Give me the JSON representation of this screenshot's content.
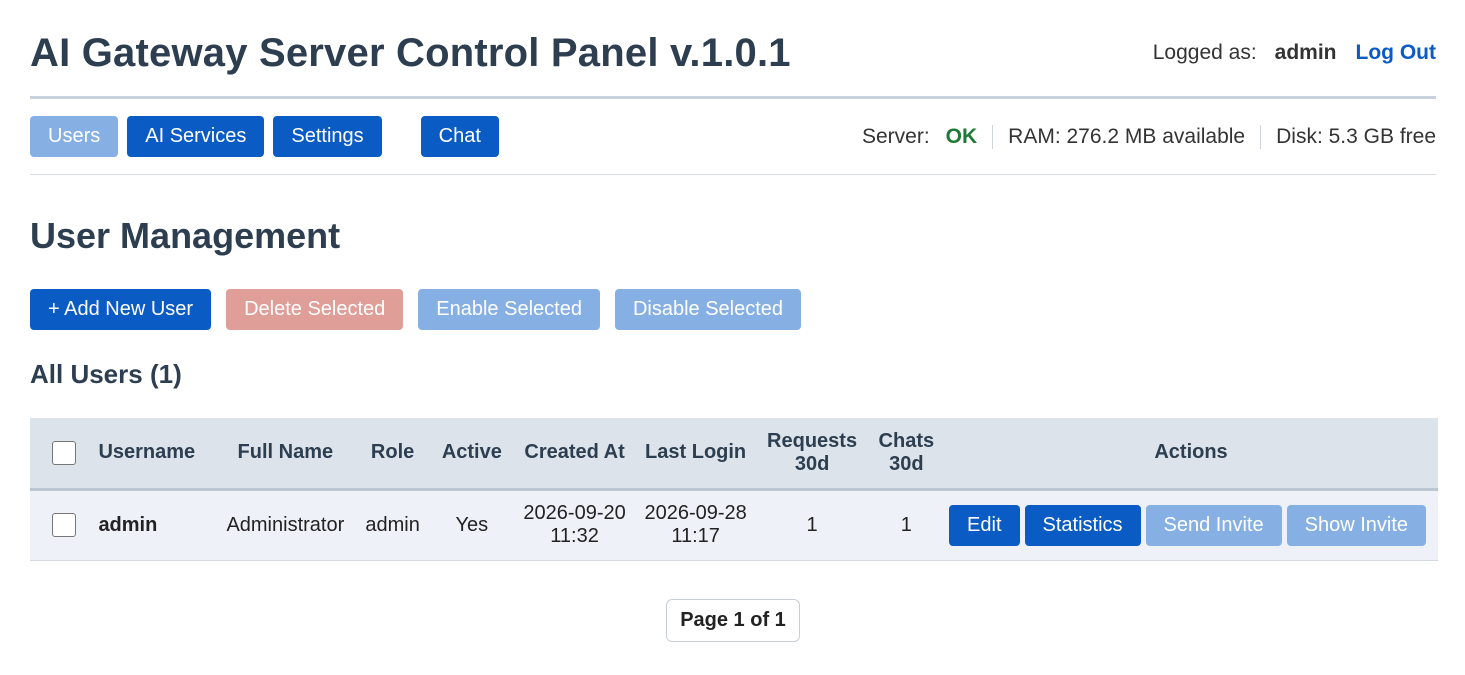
{
  "header": {
    "title": "AI Gateway Server Control Panel v.1.0.1",
    "logged_as_label": "Logged as:",
    "username": "admin",
    "logout_label": "Log Out"
  },
  "nav": {
    "users": "Users",
    "ai_services": "AI Services",
    "settings": "Settings",
    "chat": "Chat"
  },
  "status": {
    "server_label": "Server:",
    "server_value": "OK",
    "ram": "RAM: 276.2 MB available",
    "disk": "Disk: 5.3 GB free"
  },
  "page": {
    "title": "User Management",
    "add_user": "+ Add New User",
    "delete_selected": "Delete Selected",
    "enable_selected": "Enable Selected",
    "disable_selected": "Disable Selected",
    "list_title": "All Users (1)"
  },
  "table": {
    "columns": {
      "username": "Username",
      "full_name": "Full Name",
      "role": "Role",
      "active": "Active",
      "created_at": "Created At",
      "last_login": "Last Login",
      "requests_1": "Requests",
      "requests_2": "30d",
      "chats_1": "Chats",
      "chats_2": "30d",
      "actions": "Actions"
    },
    "rows": [
      {
        "username": "admin",
        "full_name": "Administrator",
        "role": "admin",
        "active": "Yes",
        "created_date": "2026-09-20",
        "created_time": "11:32",
        "login_date": "2026-09-28",
        "login_time": "11:17",
        "requests": "1",
        "chats": "1",
        "edit": "Edit",
        "statistics": "Statistics",
        "send_invite": "Send Invite",
        "show_invite": "Show Invite"
      }
    ]
  },
  "pagination": "Page 1 of 1",
  "colors": {
    "primary": "#0a5bc4",
    "primary_disabled": "#86b0e4",
    "danger_disabled": "#e09e98",
    "ok": "#1e7a36"
  }
}
